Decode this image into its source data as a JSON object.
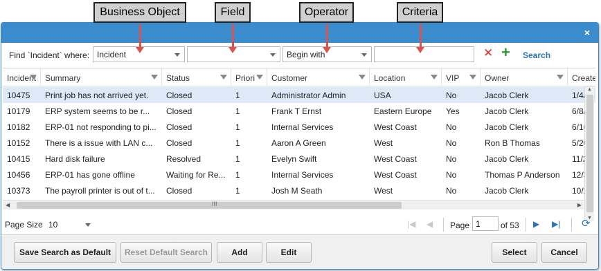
{
  "callouts": {
    "business_object": "Business Object",
    "field": "Field",
    "operator": "Operator",
    "criteria": "Criteria"
  },
  "dialog": {
    "close": "×"
  },
  "find": {
    "label": "Find `Incident` where:",
    "business_object_value": "Incident",
    "field_value": "",
    "operator_value": "Begin with",
    "criteria_value": "",
    "clear_icon": "✕",
    "add_icon": "+",
    "search_label": "Search"
  },
  "grid": {
    "headers": [
      "Incident",
      "Summary",
      "Status",
      "Priori",
      "Customer",
      "Location",
      "VIP",
      "Owner",
      "Create"
    ],
    "rows": [
      {
        "incident": "10475",
        "summary": "Print job has not arrived yet.",
        "status": "Closed",
        "priority": "1",
        "customer": "Administrator Admin",
        "location": "USA",
        "vip": "No",
        "owner": "Jacob Clerk",
        "created": "1/4/"
      },
      {
        "incident": "10179",
        "summary": "ERP system seems to be r...",
        "status": "Closed",
        "priority": "1",
        "customer": "Frank T Ernst",
        "location": "Eastern Europe",
        "vip": "Yes",
        "owner": "Jacob Clerk",
        "created": "6/8/"
      },
      {
        "incident": "10182",
        "summary": "ERP-01 not responding to pi...",
        "status": "Closed",
        "priority": "1",
        "customer": "Internal Services",
        "location": "West Coast",
        "vip": "No",
        "owner": "Jacob Clerk",
        "created": "6/16"
      },
      {
        "incident": "10152",
        "summary": "There is a issue with LAN c...",
        "status": "Closed",
        "priority": "1",
        "customer": "Aaron A Green",
        "location": "West",
        "vip": "No",
        "owner": "Ron B Thomas",
        "created": "5/20"
      },
      {
        "incident": "10415",
        "summary": "Hard disk failure",
        "status": "Resolved",
        "priority": "1",
        "customer": "Evelyn Swift",
        "location": "West Coast",
        "vip": "No",
        "owner": "Jacob Clerk",
        "created": "11/2"
      },
      {
        "incident": "10456",
        "summary": "ERP-01 has gone offline",
        "status": "Waiting for Re...",
        "priority": "1",
        "customer": "Internal Services",
        "location": "West Coast",
        "vip": "No",
        "owner": "Thomas P Anderson",
        "created": "12/3"
      },
      {
        "incident": "10373",
        "summary": "The payroll printer is out of t...",
        "status": "Closed",
        "priority": "1",
        "customer": "Josh M Seath",
        "location": "West",
        "vip": "No",
        "owner": "Jacob Clerk",
        "created": "10/2"
      }
    ]
  },
  "scroll": {
    "grip": "III"
  },
  "pager": {
    "page_size_label": "Page Size",
    "page_size_value": "10",
    "page_label": "Page",
    "page_value": "1",
    "of_label": "of 53"
  },
  "footer": {
    "save_default": "Save Search as Default",
    "reset_default": "Reset Default Search",
    "add": "Add",
    "edit": "Edit",
    "select": "Select",
    "cancel": "Cancel"
  },
  "colors": {
    "titlebar": "#3a8ccc",
    "accent": "#2a74b8",
    "arrow": "#d9534f",
    "clear": "#d9322b",
    "add": "#2f9a35",
    "selected_row": "#dde9f6"
  }
}
